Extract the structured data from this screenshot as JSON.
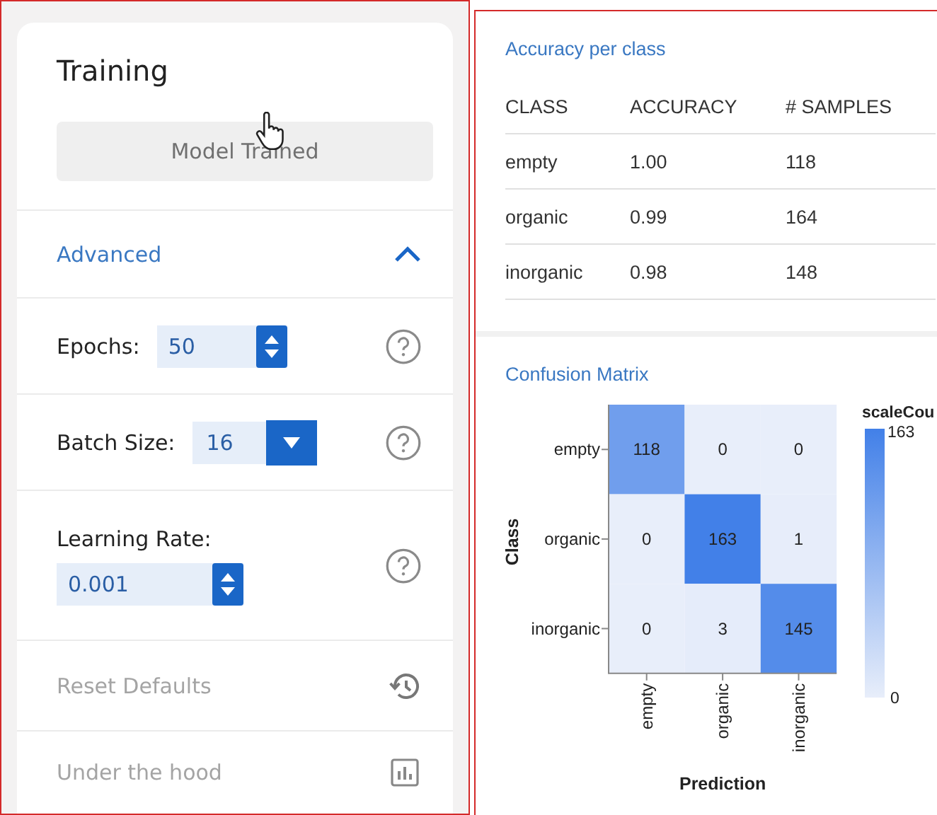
{
  "training_panel": {
    "title": "Training",
    "train_button": {
      "label": "Model Trained",
      "disabled": true
    },
    "advanced": {
      "label": "Advanced",
      "expanded": true
    },
    "settings": [
      {
        "kind": "spinner",
        "label": "Epochs:",
        "value": "50",
        "stacked": false
      },
      {
        "kind": "dropdown",
        "label": "Batch Size:",
        "value": "16",
        "stacked": false
      },
      {
        "kind": "spinner",
        "label": "Learning Rate:",
        "value": "0.001",
        "stacked": true
      }
    ],
    "actions": [
      {
        "kind": "reset",
        "label": "Reset Defaults",
        "disabled": true
      },
      {
        "kind": "chart",
        "label": "Under the hood",
        "disabled": true
      }
    ]
  },
  "accuracy": {
    "title": "Accuracy per class",
    "columns": [
      "CLASS",
      "ACCURACY",
      "# SAMPLES"
    ],
    "rows": [
      [
        "empty",
        "1.00",
        "118"
      ],
      [
        "organic",
        "0.99",
        "164"
      ],
      [
        "inorganic",
        "0.98",
        "148"
      ]
    ]
  },
  "confusion_matrix": {
    "title": "Confusion Matrix",
    "ylabel": "Class",
    "xlabel": "Prediction",
    "row_labels": [
      "empty",
      "organic",
      "inorganic"
    ],
    "column_labels": [
      "empty",
      "organic",
      "inorganic"
    ],
    "cells": [
      [
        "118",
        "0",
        "0"
      ],
      [
        "0",
        "163",
        "1"
      ],
      [
        "0",
        "3",
        "145"
      ]
    ],
    "legend": {
      "title": "scaleCou",
      "max": "163",
      "min": "0"
    }
  }
}
